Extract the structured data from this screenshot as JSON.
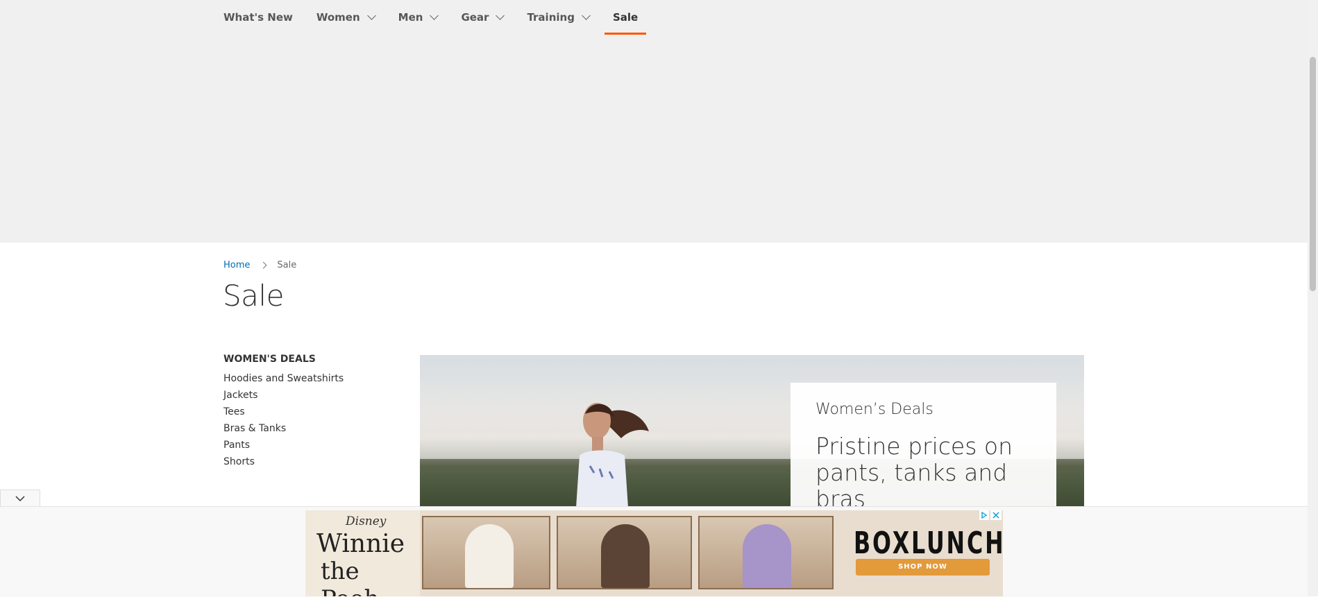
{
  "nav": {
    "items": [
      {
        "label": "What's New",
        "has_dropdown": false
      },
      {
        "label": "Women",
        "has_dropdown": true
      },
      {
        "label": "Men",
        "has_dropdown": true
      },
      {
        "label": "Gear",
        "has_dropdown": true
      },
      {
        "label": "Training",
        "has_dropdown": true
      },
      {
        "label": "Sale",
        "has_dropdown": false,
        "active": true
      }
    ]
  },
  "breadcrumb": {
    "home": "Home",
    "current": "Sale"
  },
  "page_title": "Sale",
  "sidebar": {
    "heading": "WOMEN'S DEALS",
    "items": [
      "Hoodies and Sweatshirts",
      "Jackets",
      "Tees",
      "Bras & Tanks",
      "Pants",
      "Shorts"
    ]
  },
  "hero": {
    "kicker": "Women’s Deals",
    "headline": "Pristine prices on pants, tanks and bras"
  },
  "ad": {
    "brand": "Disney",
    "title_line1": "Winnie",
    "title_line2": "the Pooh",
    "advertiser": "BOXLUNCH",
    "cta": "SHOP NOW"
  },
  "colors": {
    "accent": "#ff5501",
    "link": "#006bb4",
    "cta": "#e39a3a"
  }
}
